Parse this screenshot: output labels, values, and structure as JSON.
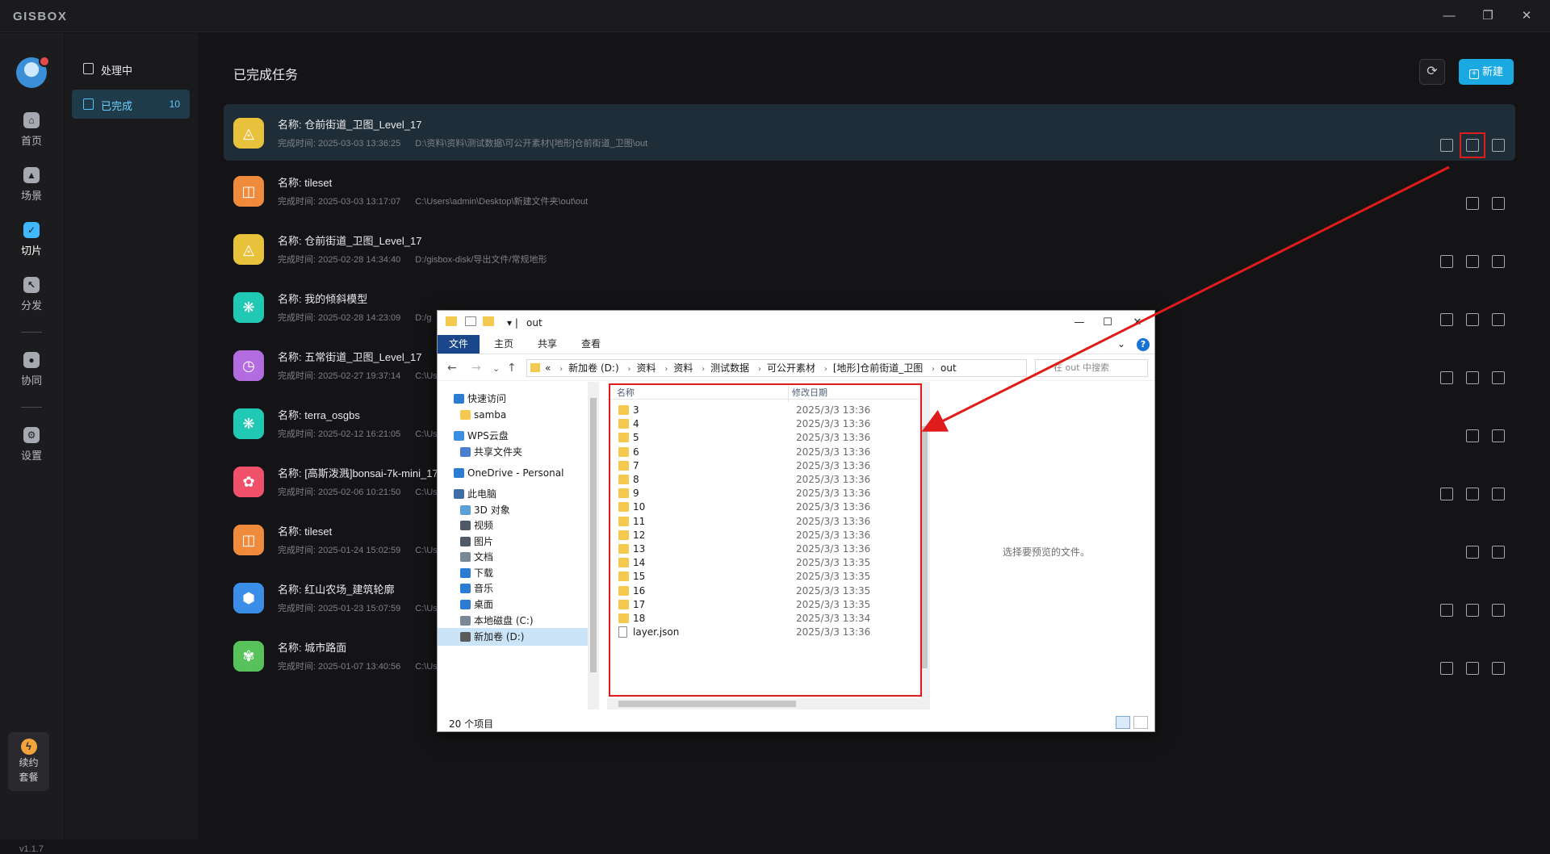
{
  "app": {
    "brand": "GISBOX",
    "version": "v1.1.7"
  },
  "window_controls": {
    "minimize": "—",
    "restore": "❐",
    "close": "✕"
  },
  "rail": {
    "items": [
      {
        "label": "首页",
        "glyph": "⌂"
      },
      {
        "label": "场景",
        "glyph": "▲"
      },
      {
        "label": "切片",
        "glyph": "✓"
      },
      {
        "label": "分发",
        "glyph": "↖"
      },
      {
        "label": "协同",
        "glyph": "●"
      },
      {
        "label": "设置",
        "glyph": "⚙"
      }
    ],
    "renew": {
      "line1": "续约",
      "line2": "套餐",
      "glyph": "ϟ"
    }
  },
  "subnav": {
    "processing": "处理中",
    "completed": "已完成",
    "completed_count": "10"
  },
  "main": {
    "title": "已完成任务",
    "new_label": "新建",
    "refresh_icon": "⟳"
  },
  "tasks": [
    {
      "name": "名称:  仓前街道_卫图_Level_17",
      "time": "完成时间:  2025-03-03 13:36:25",
      "path": "D:\\资料\\资料\\测试数据\\可公开素材\\[地形]仓前街道_卫图\\out",
      "glyph": "◬",
      "color": "#e8c23a",
      "icons": 3
    },
    {
      "name": "名称:  tileset",
      "time": "完成时间:  2025-03-03 13:17:07",
      "path": "C:\\Users\\admin\\Desktop\\新建文件夹\\out\\out",
      "glyph": "◫",
      "color": "#f08a3c",
      "icons": 2
    },
    {
      "name": "名称:  仓前街道_卫图_Level_17",
      "time": "完成时间:  2025-02-28 14:34:40",
      "path": "D:/gisbox-disk/导出文件/常规地形",
      "glyph": "◬",
      "color": "#e8c23a",
      "icons": 3
    },
    {
      "name": "名称:  我的倾斜模型",
      "time": "完成时间:  2025-02-28 14:23:09",
      "path": "D:/g",
      "glyph": "❋",
      "color": "#20c9b4",
      "icons": 3
    },
    {
      "name": "名称:  五常街道_卫图_Level_17",
      "time": "完成时间:  2025-02-27 19:37:14",
      "path": "C:\\Us",
      "glyph": "◷",
      "color": "#b36be0",
      "icons": 3
    },
    {
      "name": "名称:  terra_osgbs",
      "time": "完成时间:  2025-02-12 16:21:05",
      "path": "C:\\Us",
      "glyph": "❋",
      "color": "#20c9b4",
      "icons": 2
    },
    {
      "name": "名称:  [高斯泼溅]bonsai-7k-mini_17",
      "time": "完成时间:  2025-02-06 10:21:50",
      "path": "C:\\Us",
      "glyph": "✿",
      "color": "#f0506a",
      "icons": 3
    },
    {
      "name": "名称:  tileset",
      "time": "完成时间:  2025-01-24 15:02:59",
      "path": "C:\\Us",
      "glyph": "◫",
      "color": "#f08a3c",
      "icons": 2
    },
    {
      "name": "名称:  红山农场_建筑轮廓",
      "time": "完成时间:  2025-01-23 15:07:59",
      "path": "C:\\Us",
      "glyph": "⬢",
      "color": "#3a8ee8",
      "icons": 3
    },
    {
      "name": "名称:  城市路面",
      "time": "完成时间:  2025-01-07 13:40:56",
      "path": "C:\\Us",
      "glyph": "✾",
      "color": "#58c25a",
      "icons": 3
    }
  ],
  "explorer": {
    "title": "out",
    "ribbon": [
      "文件",
      "主页",
      "共享",
      "查看"
    ],
    "breadcrumb": [
      "«",
      "新加卷 (D:)",
      "资料",
      "资料",
      "测试数据",
      "可公开素材",
      "[地形]仓前街道_卫图",
      "out"
    ],
    "search_placeholder": "在 out 中搜索",
    "nav": [
      {
        "label": "快速访问",
        "color": "#2b7cd3",
        "indent": 0
      },
      {
        "label": "samba",
        "color": "#f3c94f",
        "indent": 1
      },
      {
        "label": "WPS云盘",
        "color": "#3b8fe0",
        "indent": 0
      },
      {
        "label": "共享文件夹",
        "color": "#4a7fd0",
        "indent": 1
      },
      {
        "label": "OneDrive - Personal",
        "color": "#2b7cd3",
        "indent": 0
      },
      {
        "label": "此电脑",
        "color": "#3d6ea8",
        "indent": 0
      },
      {
        "label": "3D 对象",
        "color": "#5aa0d8",
        "indent": 1
      },
      {
        "label": "视频",
        "color": "#4f5a66",
        "indent": 1
      },
      {
        "label": "图片",
        "color": "#4f5a66",
        "indent": 1
      },
      {
        "label": "文档",
        "color": "#7a8796",
        "indent": 1
      },
      {
        "label": "下载",
        "color": "#2b7cd3",
        "indent": 1
      },
      {
        "label": "音乐",
        "color": "#2b7cd3",
        "indent": 1
      },
      {
        "label": "桌面",
        "color": "#2b7cd3",
        "indent": 1
      },
      {
        "label": "本地磁盘 (C:)",
        "color": "#7a8796",
        "indent": 1
      },
      {
        "label": "新加卷 (D:)",
        "color": "#5b5b5b",
        "indent": 1
      }
    ],
    "col_name": "名称",
    "col_date": "修改日期",
    "files": [
      {
        "name": "3",
        "date": "2025/3/3 13:36",
        "type": "folder"
      },
      {
        "name": "4",
        "date": "2025/3/3 13:36",
        "type": "folder"
      },
      {
        "name": "5",
        "date": "2025/3/3 13:36",
        "type": "folder"
      },
      {
        "name": "6",
        "date": "2025/3/3 13:36",
        "type": "folder"
      },
      {
        "name": "7",
        "date": "2025/3/3 13:36",
        "type": "folder"
      },
      {
        "name": "8",
        "date": "2025/3/3 13:36",
        "type": "folder"
      },
      {
        "name": "9",
        "date": "2025/3/3 13:36",
        "type": "folder"
      },
      {
        "name": "10",
        "date": "2025/3/3 13:36",
        "type": "folder"
      },
      {
        "name": "11",
        "date": "2025/3/3 13:36",
        "type": "folder"
      },
      {
        "name": "12",
        "date": "2025/3/3 13:36",
        "type": "folder"
      },
      {
        "name": "13",
        "date": "2025/3/3 13:36",
        "type": "folder"
      },
      {
        "name": "14",
        "date": "2025/3/3 13:35",
        "type": "folder"
      },
      {
        "name": "15",
        "date": "2025/3/3 13:35",
        "type": "folder"
      },
      {
        "name": "16",
        "date": "2025/3/3 13:35",
        "type": "folder"
      },
      {
        "name": "17",
        "date": "2025/3/3 13:35",
        "type": "folder"
      },
      {
        "name": "18",
        "date": "2025/3/3 13:34",
        "type": "folder"
      },
      {
        "name": "layer.json",
        "date": "2025/3/3 13:36",
        "type": "json"
      }
    ],
    "preview_message": "选择要预览的文件。",
    "status": "20 个项目"
  },
  "colors": {
    "accent": "#1aa9e0",
    "highlight": "#e01b1b",
    "selected_row": "#1f2d38"
  }
}
